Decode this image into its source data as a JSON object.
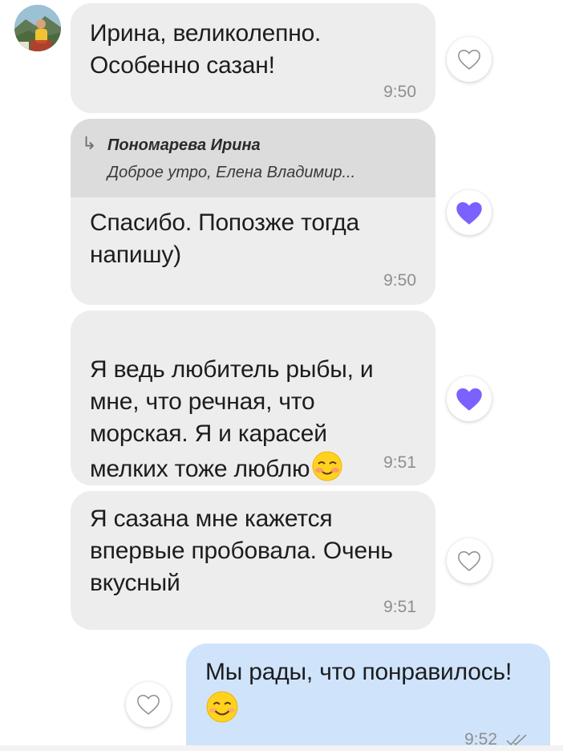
{
  "theme": {
    "incoming_bubble": "#ededed",
    "outgoing_bubble": "#cfe4fb",
    "reply_quote_bg": "#dcdcdc",
    "liked_heart": "#7b61ff",
    "time_color": "#8e8e93"
  },
  "messages": [
    {
      "direction": "incoming",
      "text": "Ирина, великолепно.\nОсобенно сазан!",
      "time": "9:50",
      "liked": false,
      "like_icon": "heart-outline-icon"
    },
    {
      "direction": "incoming",
      "reply_to": {
        "author": "Пономарева Ирина",
        "snippet": "Доброе утро, Елена Владимир..."
      },
      "text": "Спасибо. Попозже тогда\nнапишу)",
      "time": "9:50",
      "liked": true,
      "like_icon": "heart-filled-icon"
    },
    {
      "direction": "incoming",
      "text": "Я ведь любитель рыбы, и\nмне, что речная, что\nморская. Я и карасей\nмелких тоже люблю",
      "emoji": "smiling-face-blush-emoji",
      "time": "9:51",
      "liked": true,
      "like_icon": "heart-filled-icon"
    },
    {
      "direction": "incoming",
      "text": "Я сазана мне кажется\nвпервые пробовала. Очень\nвкусный",
      "time": "9:51",
      "liked": false,
      "like_icon": "heart-outline-icon"
    },
    {
      "direction": "outgoing",
      "text": "Мы рады, что понравилось!",
      "emoji": "smiling-face-emoji",
      "time": "9:52",
      "status_icon": "double-check-icon",
      "liked": false,
      "like_icon": "heart-outline-icon"
    }
  ]
}
